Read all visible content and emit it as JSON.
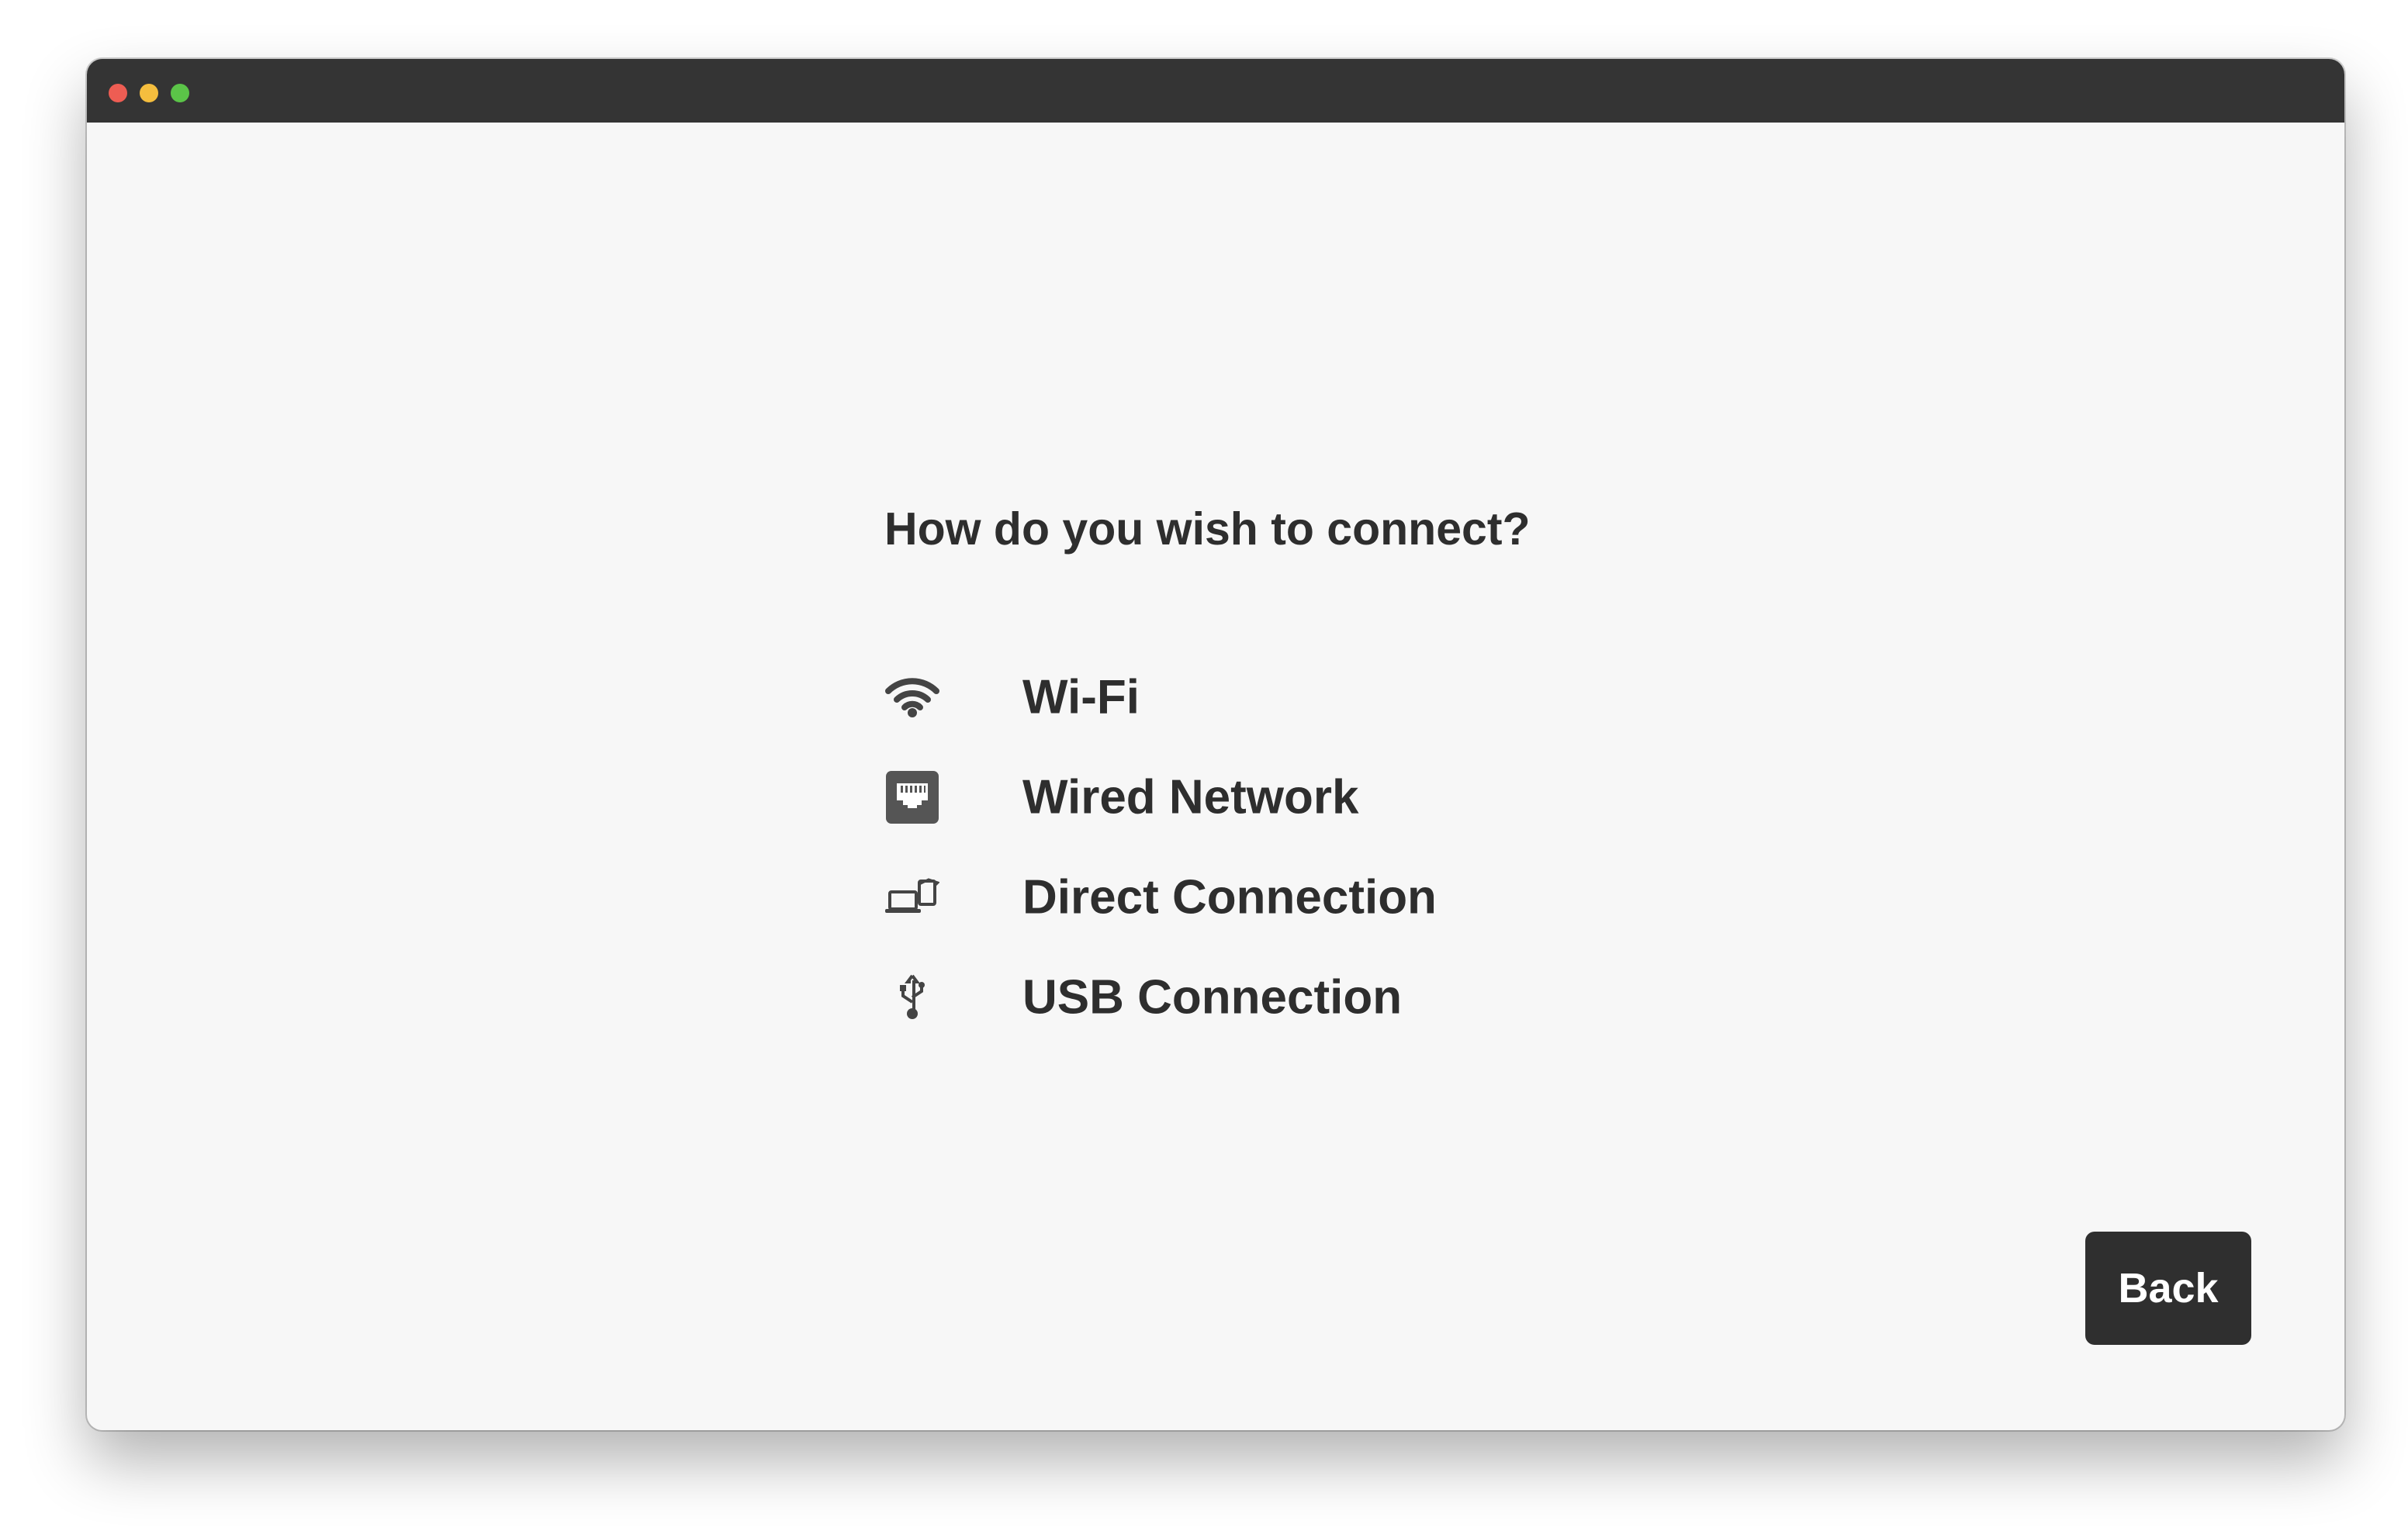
{
  "window": {
    "traffic_lights": [
      {
        "name": "close",
        "color": "#ee5d53"
      },
      {
        "name": "minimize",
        "color": "#f5be3e"
      },
      {
        "name": "zoom",
        "color": "#5bc448"
      }
    ],
    "titlebar_color": "#343434",
    "background_color": "#f7f7f7"
  },
  "main": {
    "question": "How do you wish to connect?",
    "options": [
      {
        "label": "Wi-Fi",
        "icon": "wifi-icon"
      },
      {
        "label": "Wired Network",
        "icon": "ethernet-port-icon"
      },
      {
        "label": "Direct Connection",
        "icon": "laptop-to-device-icon"
      },
      {
        "label": "USB Connection",
        "icon": "usb-icon"
      }
    ]
  },
  "footer": {
    "back_label": "Back"
  }
}
